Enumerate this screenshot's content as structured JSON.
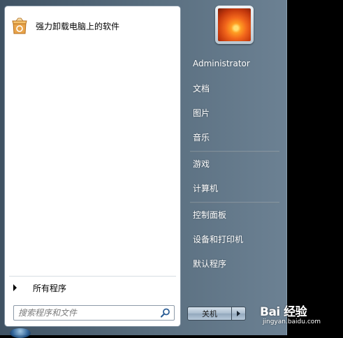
{
  "left_pane": {
    "pinned_programs": [
      {
        "label": "强力卸载电脑上的软件",
        "icon": "uninstaller-box-icon"
      }
    ],
    "all_programs_label": "所有程序",
    "search": {
      "placeholder": "搜索程序和文件",
      "icon": "search-icon"
    }
  },
  "right_pane": {
    "user_name": "Administrator",
    "items": [
      {
        "label": "文档"
      },
      {
        "label": "图片"
      },
      {
        "label": "音乐"
      },
      {
        "label": "游戏"
      },
      {
        "label": "计算机"
      },
      {
        "label": "控制面板"
      },
      {
        "label": "设备和打印机"
      },
      {
        "label": "默认程序"
      }
    ],
    "shutdown_label": "关机"
  },
  "watermark": {
    "brand": "Bai 经验",
    "url": "jingyan.baidu.com"
  }
}
